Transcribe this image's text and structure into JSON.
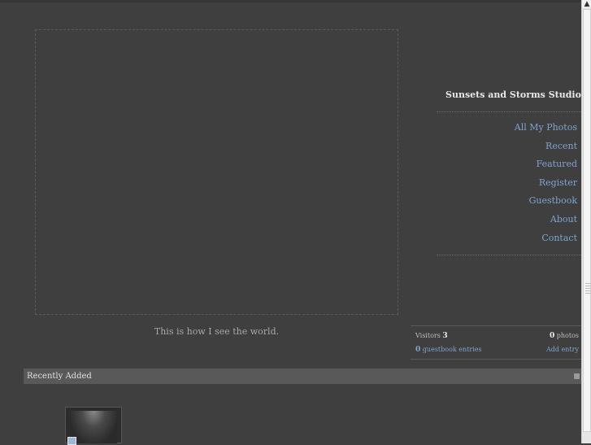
{
  "caption": "This is how I see the world.",
  "site_title": "Sunsets and Storms Studios",
  "nav": [
    {
      "label": "All My Photos"
    },
    {
      "label": "Recent"
    },
    {
      "label": "Featured"
    },
    {
      "label": "Register"
    },
    {
      "label": "Guestbook"
    },
    {
      "label": "About"
    },
    {
      "label": "Contact"
    }
  ],
  "stats": {
    "visitors_label": "Visitors",
    "visitors_count": "3",
    "photos_count": "0",
    "photos_label": "photos",
    "guestbook_count": "0",
    "guestbook_label": "guestbook entries",
    "add_entry": "Add entry"
  },
  "recent": {
    "label": "Recently Added",
    "rss_icon": "rss-icon"
  },
  "scrollbar": {
    "up_arrow": "▲"
  }
}
